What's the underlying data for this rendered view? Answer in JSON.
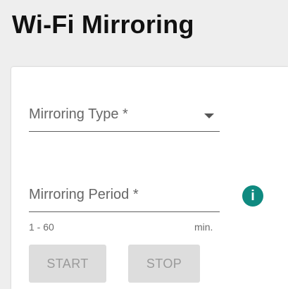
{
  "page": {
    "title": "Wi-Fi Mirroring"
  },
  "form": {
    "mirroring_type": {
      "label": "Mirroring Type *",
      "icon": "chevron-down-icon"
    },
    "mirroring_period": {
      "label": "Mirroring Period *",
      "helper_range": "1 - 60",
      "helper_unit": "min.",
      "info_icon": "info-icon",
      "info_glyph": "i"
    },
    "buttons": {
      "start_label": "START",
      "stop_label": "STOP"
    }
  },
  "colors": {
    "accent": "#0f8a80",
    "disabled_button_bg": "#dddddd",
    "disabled_button_text": "#9a9a9a"
  }
}
